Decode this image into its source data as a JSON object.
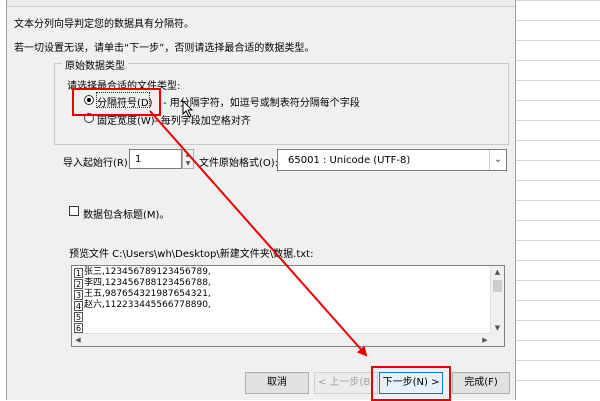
{
  "wizard": {
    "intro_text": "文本分列向导判定您的数据具有分隔符。",
    "instruction_text": "若一切设置无误，请单击“下一步”，否则请选择最合适的数据类型。",
    "group_title": "原始数据类型",
    "choose_label": "请选择最合适的文件类型:",
    "option_delimited": {
      "label": "分隔符号(D)",
      "description": "- 用分隔字符，如逗号或制表符分隔每个字段",
      "selected": true
    },
    "option_fixed": {
      "label": "固定宽度(W)",
      "description": "- 每列字段加空格对齐",
      "selected": false
    },
    "start_row_label": "导入起始行(R):",
    "start_row_value": "1",
    "origin_label": "文件原始格式(O):",
    "origin_value": "65001 : Unicode (UTF-8)",
    "header_checkbox_label": "数据包含标题(M)。",
    "header_checked": false,
    "preview_label": "预览文件 C:\\Users\\wh\\Desktop\\新建文件夹\\数据.txt:",
    "preview_rows": [
      {
        "num": "1",
        "text": "张三,123456789123456789,"
      },
      {
        "num": "2",
        "text": "李四,123456788123456788,"
      },
      {
        "num": "3",
        "text": "王五,987654321987654321,"
      },
      {
        "num": "4",
        "text": "赵六,112233445566778890,"
      },
      {
        "num": "5",
        "text": ""
      },
      {
        "num": "6",
        "text": ""
      }
    ]
  },
  "buttons": {
    "cancel": "取消",
    "back": "< 上一步(B)",
    "next": "下一步(N) >",
    "finish": "完成(F)"
  },
  "colors": {
    "annotation": "#e60000",
    "dialog_bg": "#f0f0f0"
  }
}
